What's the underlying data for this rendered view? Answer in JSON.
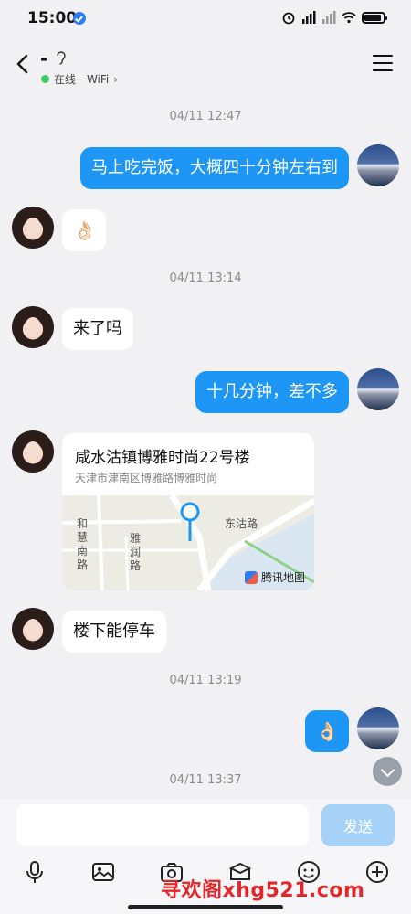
{
  "status_bar": {
    "time": "15:00"
  },
  "header": {
    "title": "-",
    "online_status": "在线 - WiFi",
    "chevron": "›"
  },
  "timestamps": [
    "04/11 12:47",
    "04/11 13:14",
    "04/11 13:19",
    "04/11 13:37"
  ],
  "messages": [
    {
      "side": "out",
      "text": "马上吃完饭，大概四十分钟左右到"
    },
    {
      "side": "in",
      "text": "👌🏻"
    },
    {
      "side": "in",
      "text": "来了吗"
    },
    {
      "side": "out",
      "text": "十几分钟，差不多"
    },
    {
      "side": "in",
      "text": "楼下能停车"
    },
    {
      "side": "out",
      "text": "👌🏻"
    }
  ],
  "location_card": {
    "title": "咸水沽镇博雅时尚22号楼",
    "address": "天津市津南区博雅路博雅时尚",
    "map_labels": {
      "road1": "和慧南路",
      "road2": "雅润路",
      "road3": "东沽路"
    },
    "brand": "腾讯地图"
  },
  "input": {
    "value": "",
    "placeholder": "",
    "send_label": "发送"
  },
  "toolbar": [
    "mic-icon",
    "image-icon",
    "camera-icon",
    "red-packet-icon",
    "emoji-icon",
    "plus-icon"
  ],
  "watermark": "寻欢阁xhg521.com",
  "colors": {
    "outgoing_bubble": "#1e96f5",
    "send_button": "#a6d2f7",
    "online_dot": "#3ecb6c"
  }
}
